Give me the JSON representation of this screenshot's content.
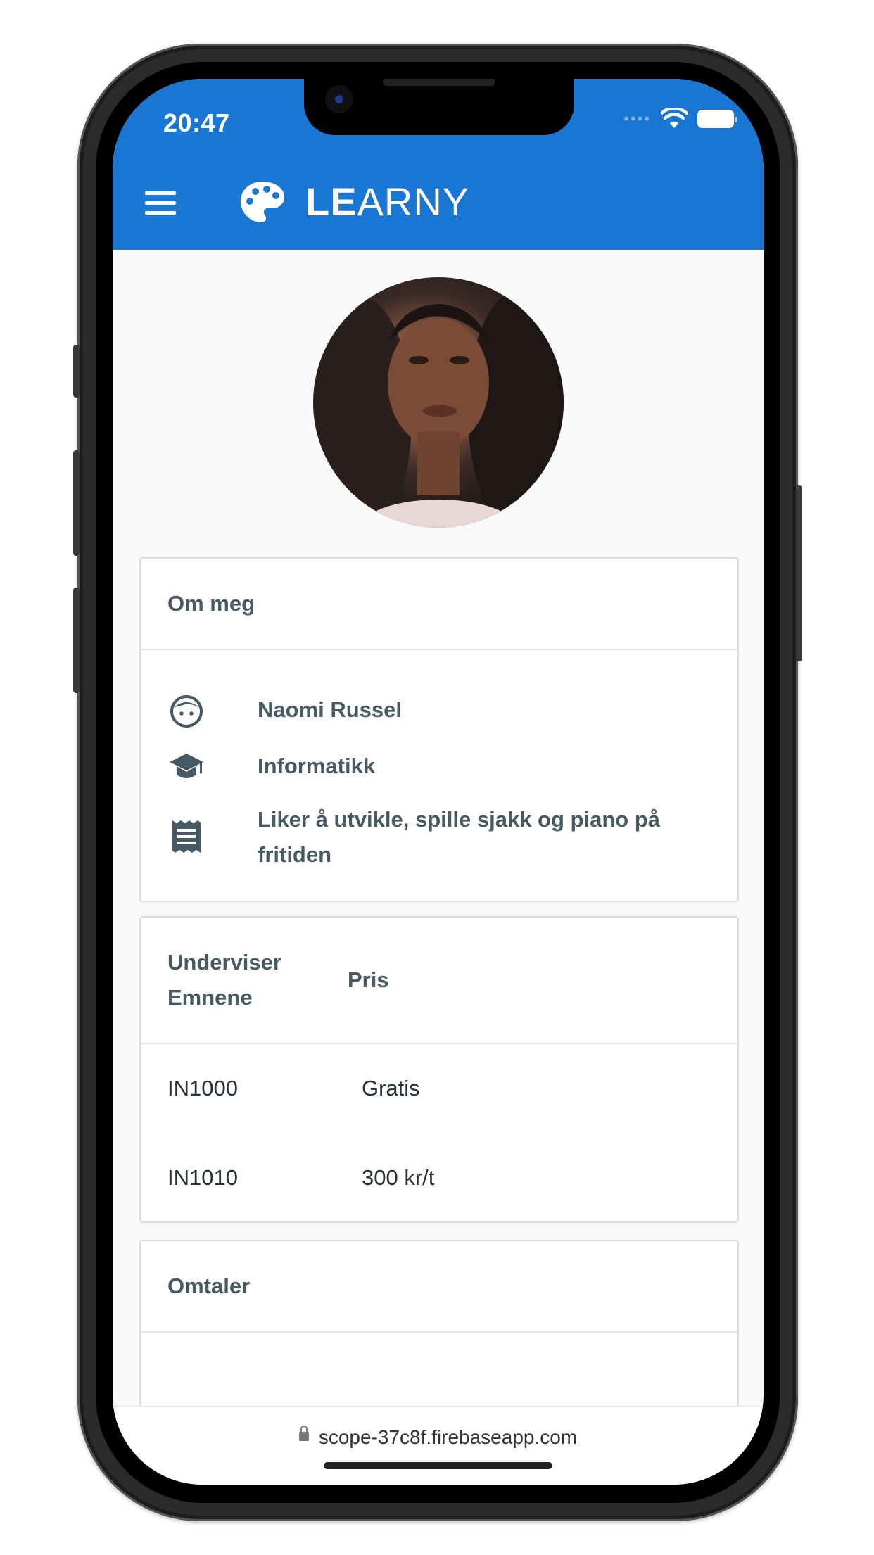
{
  "status_bar": {
    "time": "20:47"
  },
  "app_bar": {
    "brand_bold": "LE",
    "brand_light": "ARNY"
  },
  "about": {
    "title": "Om meg",
    "name": "Naomi Russel",
    "study": "Informatikk",
    "bio": "Liker å utvikle, spille sjakk og piano på fritiden"
  },
  "courses": {
    "header_subjects": "Underviser Emnene",
    "header_price": "Pris",
    "rows": [
      {
        "code": "IN1000",
        "price": "Gratis"
      },
      {
        "code": "IN1010",
        "price": "300 kr/t"
      }
    ]
  },
  "reviews": {
    "title": "Omtaler"
  },
  "browser": {
    "url": "scope-37c8f.firebaseapp.com"
  },
  "colors": {
    "primary": "#1976d2",
    "heading_text": "#455a64"
  }
}
